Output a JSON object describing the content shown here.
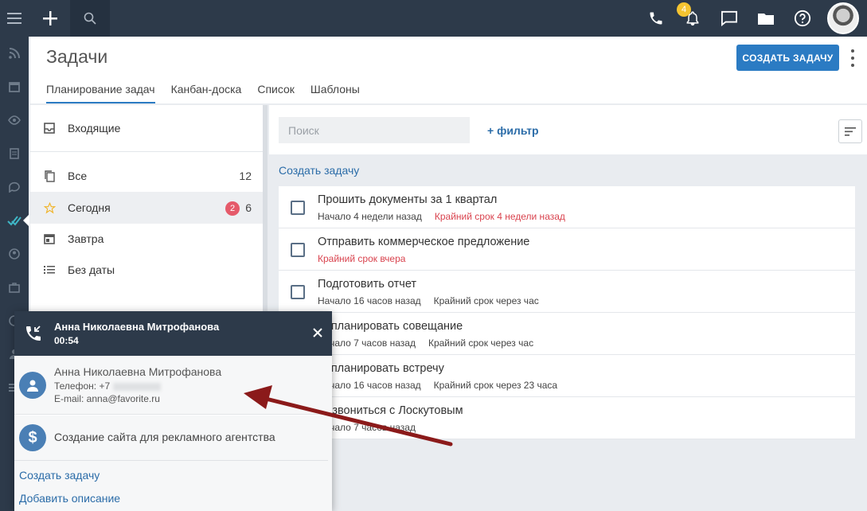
{
  "topbar": {
    "notification_count": "4"
  },
  "header": {
    "title": "Задачи",
    "create_button": "СОЗДАТЬ ЗАДАЧУ",
    "tabs": [
      {
        "label": "Планирование задач",
        "active": true
      },
      {
        "label": "Канбан-доска"
      },
      {
        "label": "Список"
      },
      {
        "label": "Шаблоны"
      }
    ]
  },
  "sidebar": {
    "inbox": "Входящие",
    "items": [
      {
        "label": "Все",
        "count": "12"
      },
      {
        "label": "Сегодня",
        "badge": "2",
        "count": "6"
      },
      {
        "label": "Завтра"
      },
      {
        "label": "Без даты"
      }
    ]
  },
  "content": {
    "search_placeholder": "Поиск",
    "filter": "+ фильтр",
    "create_link": "Создать задачу",
    "tasks": [
      {
        "title": "Прошить документы за 1 квартал",
        "start": "Начало 4 недели назад",
        "deadline": "Крайний срок 4 недели назад"
      },
      {
        "title": "Отправить коммерческое предложение",
        "deadline": "Крайний срок вчера"
      },
      {
        "title": "Подготовить отчет",
        "start": "Начало 16 часов назад",
        "deadline": "Крайний срок через час"
      },
      {
        "title": "Запланировать совещание",
        "start": "Начало 7 часов назад",
        "deadline": "Крайний срок через час"
      },
      {
        "title": "Запланировать встречу",
        "start": "Начало 16 часов назад",
        "deadline": "Крайний срок через 23 часа"
      },
      {
        "title": "Созвониться с Лоскутовым",
        "start": "Начало 7 часов назад"
      }
    ]
  },
  "call_popup": {
    "caller": "Анна Николаевна Митрофанова",
    "duration": "00:54",
    "contact_name": "Анна Николаевна Митрофанова",
    "phone": "Телефон: +7",
    "email": "E-mail: anna@favorite.ru",
    "deal": "Создание сайта для рекламного агентства",
    "create_task": "Создать задачу",
    "add_description": "Добавить описание"
  },
  "colors": {
    "accent": "#2b7bc3",
    "nav": "#2d3a4a",
    "link": "#2b6ca8",
    "deadline_red": "#d9434e",
    "arrow": "#8b1a1a"
  }
}
